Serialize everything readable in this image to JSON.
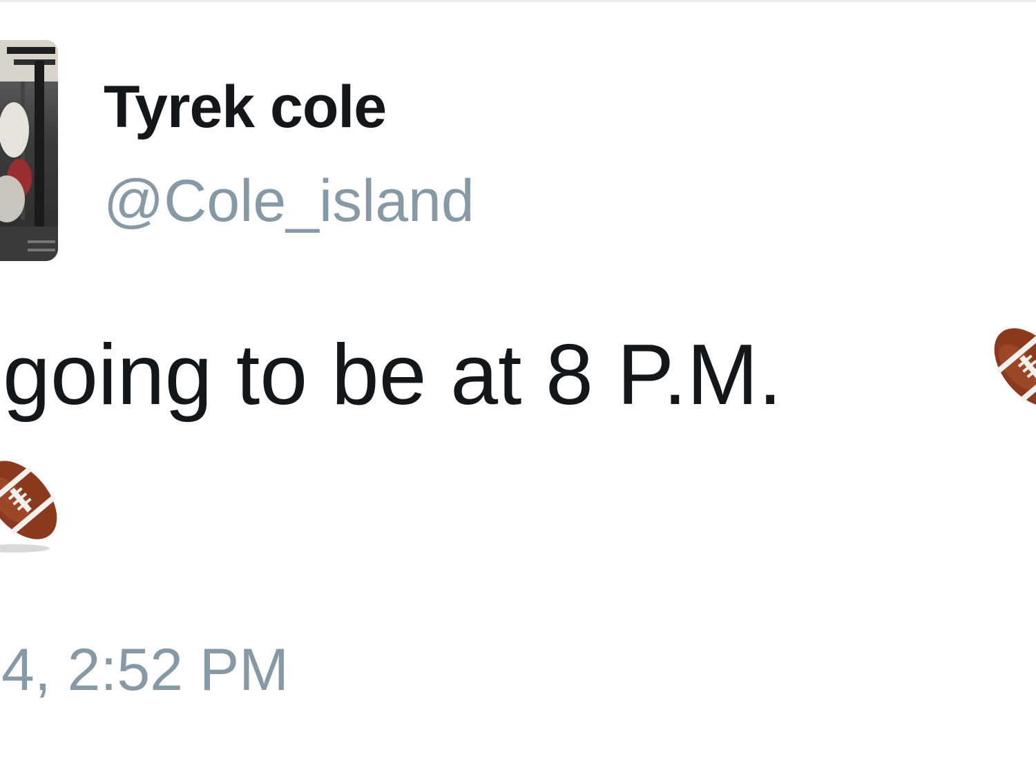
{
  "tweet": {
    "display_name": "Tyrek cole",
    "handle": "@Cole_island",
    "text": "going to be at 8 P.M.",
    "emoji": [
      "american-football-icon",
      "american-football-icon"
    ],
    "timestamp": "4, 2:52 PM"
  },
  "colors": {
    "name": "#14171a",
    "secondary": "#8899a6",
    "background": "#ffffff",
    "football_brown": "#8b3a1f"
  }
}
